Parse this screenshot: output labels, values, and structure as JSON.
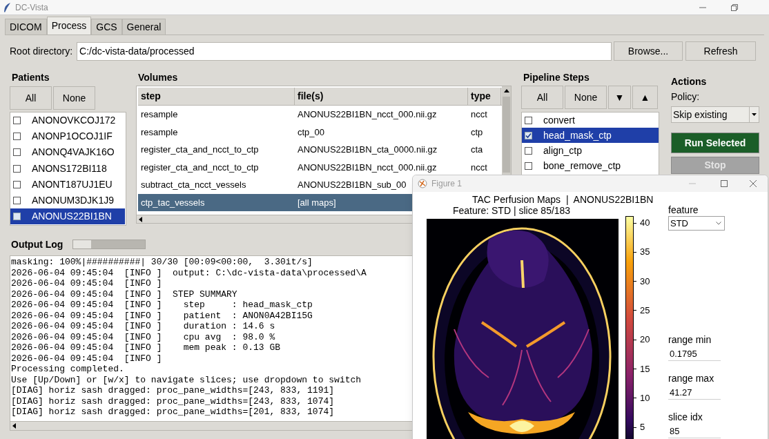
{
  "window": {
    "title": "DC-Vista"
  },
  "tabs": [
    {
      "label": "DICOM",
      "selected": false
    },
    {
      "label": "Process",
      "selected": true
    },
    {
      "label": "GCS",
      "selected": false
    },
    {
      "label": "General",
      "selected": false
    }
  ],
  "root_directory": {
    "label": "Root directory:",
    "value": "C:/dc-vista-data/processed",
    "buttons": [
      "Browse...",
      "Refresh"
    ]
  },
  "patients": {
    "title": "Patients",
    "buttons": [
      "All",
      "None"
    ],
    "items": [
      {
        "name": "ANONOVKCOJ172",
        "checked": false,
        "selected": false
      },
      {
        "name": "ANONP1OCOJ1IF",
        "checked": false,
        "selected": false
      },
      {
        "name": "ANONQ4VAJK16O",
        "checked": false,
        "selected": false
      },
      {
        "name": "ANONS172BI118",
        "checked": false,
        "selected": false
      },
      {
        "name": "ANONT187UJ1EU",
        "checked": false,
        "selected": false
      },
      {
        "name": "ANONUM3DJK1J9",
        "checked": false,
        "selected": false
      },
      {
        "name": "ANONUS22BI1BN",
        "checked": false,
        "selected": true
      }
    ]
  },
  "volumes": {
    "title": "Volumes",
    "columns": [
      "step",
      "file(s)",
      "type"
    ],
    "rows": [
      {
        "step": "resample",
        "file": "ANONUS22BI1BN_ncct_000.nii.gz",
        "type": "ncct",
        "selected": false
      },
      {
        "step": "resample",
        "file": "ctp_00",
        "type": "ctp",
        "selected": false
      },
      {
        "step": "register_cta_and_ncct_to_ctp",
        "file": "ANONUS22BI1BN_cta_0000.nii.gz",
        "type": "cta",
        "selected": false
      },
      {
        "step": "register_cta_and_ncct_to_ctp",
        "file": "ANONUS22BI1BN_ncct_000.nii.gz",
        "type": "ncct",
        "selected": false
      },
      {
        "step": "subtract_cta_ncct_vessels",
        "file": "ANONUS22BI1BN_sub_00",
        "selected": false
      },
      {
        "step": "ctp_tac_vessels",
        "file": "[all maps]",
        "selected": true
      }
    ]
  },
  "pipeline": {
    "title": "Pipeline Steps",
    "buttons": [
      {
        "kind": "text",
        "label": "All"
      },
      {
        "kind": "text",
        "label": "None"
      },
      {
        "kind": "arrow",
        "label": "▼"
      },
      {
        "kind": "arrow",
        "label": "▲"
      }
    ],
    "items": [
      {
        "name": "convert",
        "checked": false,
        "selected": false
      },
      {
        "name": "head_mask_ctp",
        "checked": true,
        "selected": true
      },
      {
        "name": "align_ctp",
        "checked": false,
        "selected": false
      },
      {
        "name": "bone_remove_ctp",
        "checked": false,
        "selected": false
      }
    ]
  },
  "actions": {
    "title": "Actions",
    "policy_label": "Policy:",
    "policy_value": "Skip existing",
    "run_button": {
      "label": "Run Selected",
      "disabled": false
    },
    "stop_button": {
      "label": "Stop",
      "disabled": true
    }
  },
  "output_log": {
    "title": "Output Log",
    "level": 0.25,
    "lines": [
      "masking: 100%|##########| 30/30 [00:09<00:00,  3.30it/s]",
      "2026-06-04 09:45:04  [INFO ]  output: C:\\dc-vista-data\\processed\\A",
      "2026-06-04 09:45:04  [INFO ]",
      "2026-06-04 09:45:04  [INFO ]  STEP SUMMARY",
      "2026-06-04 09:45:04  [INFO ]    step     : head_mask_ctp",
      "2026-06-04 09:45:04  [INFO ]    patient  : ANON0A42BI15G",
      "2026-06-04 09:45:04  [INFO ]    duration : 14.6 s",
      "2026-06-04 09:45:04  [INFO ]    cpu avg  : 98.0 %",
      "2026-06-04 09:45:04  [INFO ]    mem peak : 0.13 GB",
      "2026-06-04 09:45:04  [INFO ]",
      "Processing completed.",
      "Use [Up/Down] or [w/x] to navigate slices; use dropdown to switch",
      "[DIAG] horiz sash dragged: proc_pane_widths=[243, 833, 1191]",
      "[DIAG] horiz sash dragged: proc_pane_widths=[243, 833, 1074]",
      "[DIAG] horiz sash dragged: proc_pane_widths=[201, 833, 1074]"
    ]
  },
  "figure": {
    "title": "Figure 1",
    "plot_title": "TAC Perfusion Maps  |  ANONUS22BI1BN",
    "subtitle": "Feature: STD | slice 85/183",
    "colorbar_ticks": [
      "40",
      "35",
      "30",
      "25",
      "20",
      "15",
      "10",
      "5"
    ],
    "controls": [
      {
        "kind": "select",
        "label": "feature",
        "value": "STD"
      },
      {
        "kind": "input",
        "label": "range min",
        "value": "0.1795"
      },
      {
        "kind": "input",
        "label": "range max",
        "value": "41.27"
      },
      {
        "kind": "input",
        "label": "slice idx",
        "value": "85"
      }
    ]
  }
}
